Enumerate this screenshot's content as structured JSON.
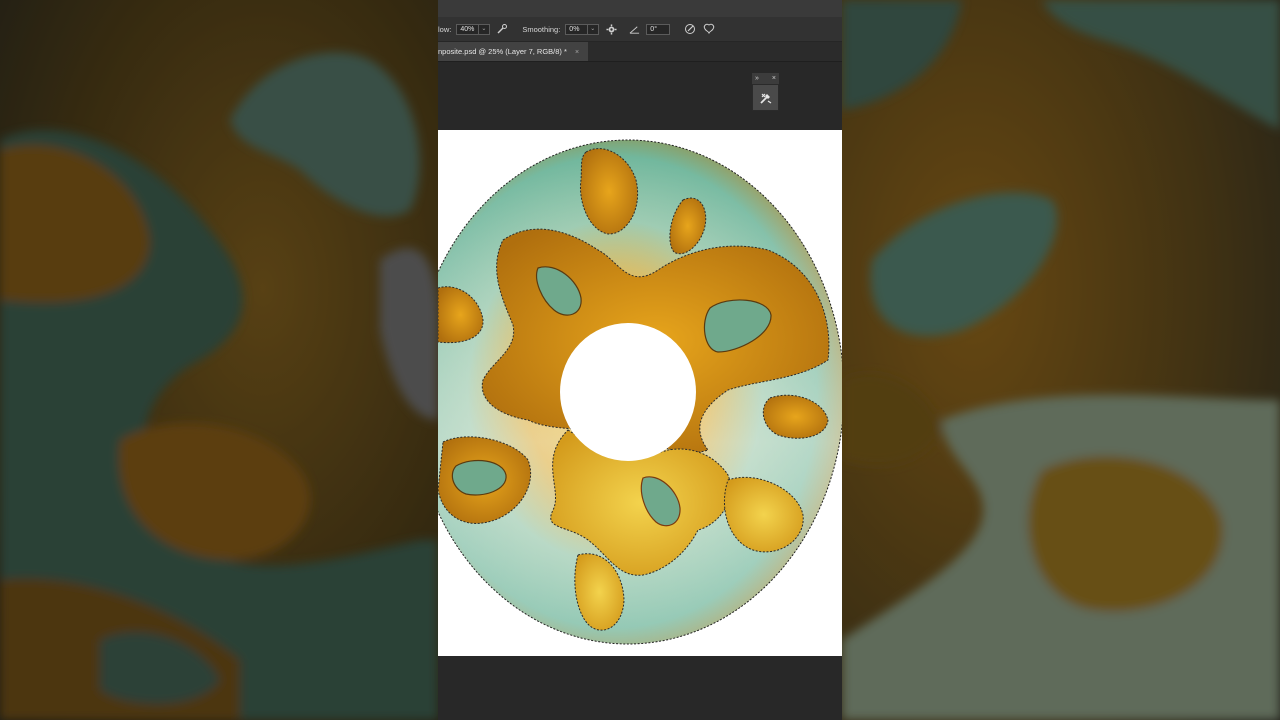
{
  "options_bar": {
    "flow_label": "low:",
    "flow_value": "40%",
    "smoothing_label": "Smoothing:",
    "smoothing_value": "0%",
    "angle_value": "0°",
    "icons": [
      "airbrush-icon",
      "gear-icon",
      "angle-icon",
      "pressure-icon",
      "symmetry-icon"
    ]
  },
  "document": {
    "tab_title": "nposite.psd @ 25% (Layer 7, RGB/8) *",
    "tab_close": "×"
  },
  "floating_panel": {
    "expand_glyph": "»",
    "close_glyph": "×",
    "icon": "tool-presets-icon"
  },
  "colors": {
    "canvas": "#ffffff",
    "workspace": "#282828",
    "iris_green": "#6db59a",
    "iris_amber": "#c98a12",
    "iris_yellow": "#e8c040"
  }
}
